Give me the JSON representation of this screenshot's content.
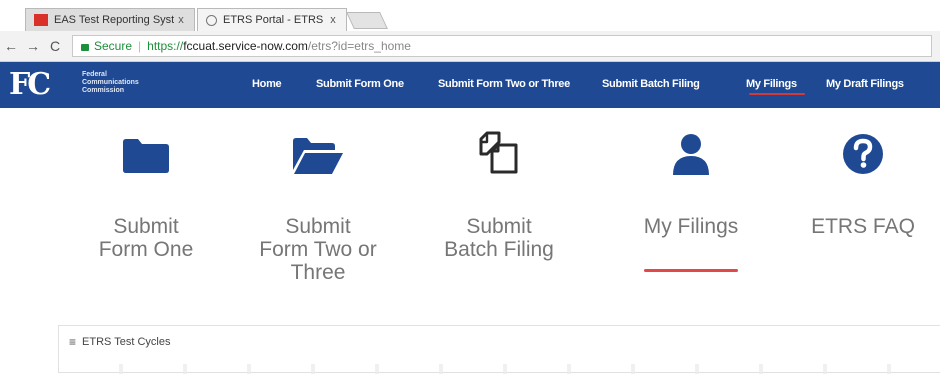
{
  "browser": {
    "tabs": [
      {
        "title": "EAS Test Reporting Syster",
        "close": "x"
      },
      {
        "title": "ETRS Portal - ETRS Home",
        "close": "x"
      }
    ],
    "nav": {
      "back": "←",
      "forward": "→",
      "reload": "C"
    },
    "address": {
      "security_label": "Secure",
      "separator": "|",
      "scheme": "https://",
      "host": "fccuat.service-now.com",
      "path": "/etrs?id=etrs_home"
    }
  },
  "header": {
    "logo": "FC",
    "org_name_lines": [
      "Federal",
      "Communications",
      "Commission"
    ],
    "nav": [
      {
        "label": "Home"
      },
      {
        "label": "Submit Form One"
      },
      {
        "label": "Submit Form Two or Three"
      },
      {
        "label": "Submit Batch Filing"
      },
      {
        "label": "My Filings",
        "active": true
      },
      {
        "label": "My Draft Filings"
      }
    ]
  },
  "tiles": [
    {
      "icon": "folder-icon",
      "label_lines": [
        "Submit",
        "Form One"
      ]
    },
    {
      "icon": "folder-open-icon",
      "label_lines": [
        "Submit",
        "Form Two or",
        "Three"
      ]
    },
    {
      "icon": "copy-files-icon",
      "label_lines": [
        "Submit",
        "Batch Filing"
      ]
    },
    {
      "icon": "user-icon",
      "label_lines": [
        "My Filings"
      ],
      "active": true
    },
    {
      "icon": "question-circle-icon",
      "label_lines": [
        "ETRS FAQ"
      ]
    }
  ],
  "panel": {
    "menu_icon": "≡",
    "title": "ETRS Test Cycles"
  },
  "colors": {
    "brand_blue": "#1f4a93",
    "icon_blue": "#1f4a93",
    "accent_red": "#e34848",
    "label_grey": "#767676"
  }
}
